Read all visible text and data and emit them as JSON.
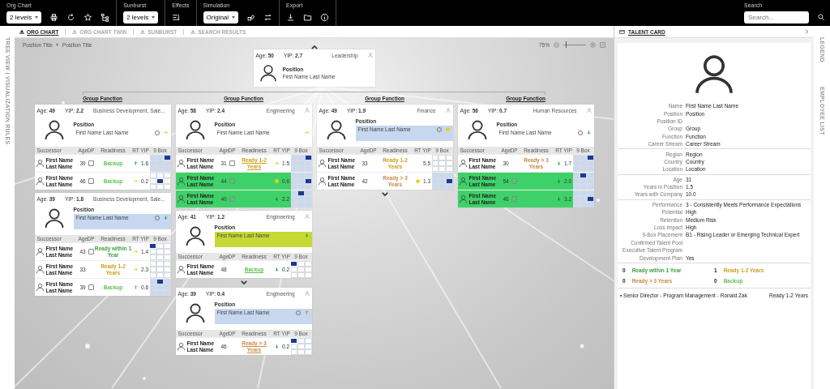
{
  "toolbar": {
    "groups": [
      {
        "label": "Org Chart",
        "dropdown": "2 levels"
      },
      {
        "label": "Sunburst",
        "dropdown": "2 levels"
      },
      {
        "label": "Effects"
      },
      {
        "label": "Simulation",
        "dropdown": "Original"
      },
      {
        "label": "Export"
      }
    ],
    "search": {
      "label": "Search",
      "placeholder": "Search..."
    }
  },
  "side_left": {
    "label": "TREE VIEW / VISUALIZATION RULES"
  },
  "tabs": [
    {
      "label": "ORG CHART",
      "selected": true
    },
    {
      "label": "ORG CHART TWIN",
      "selected": false
    },
    {
      "label": "SUNBURST",
      "selected": false
    },
    {
      "label": "SEARCH RESULTS",
      "selected": false
    }
  ],
  "breadcrumb": [
    "Position Title",
    "Position Title"
  ],
  "zoom": {
    "reading": "75%",
    "level": 0.1
  },
  "top_card": {
    "age": "Age: **50**",
    "yip": "YIP: **2.7**",
    "function": "Leadership",
    "position": "Position",
    "name": "First Name Last Name"
  },
  "columns": [
    {
      "title": "Group Function",
      "cards": [
        {
          "age": "Age: **49**",
          "yip": "YIP: **2.2**",
          "function": "Business Development, Sale...",
          "position": "Position",
          "name": {
            "text": "First Name Last Name",
            "highlighted": false
          },
          "status_icon": true,
          "rt": {
            "kind": "arrow-right",
            "color": "#e8d21a"
          },
          "more_below": false,
          "headers": [
            "Successor",
            "Age",
            "DP",
            "Readiness",
            "RT",
            "YIP",
            "9 Box"
          ],
          "successors": [
            {
              "first": "First Name",
              "last": "Last Name",
              "age": "39",
              "dp": true,
              "readiness": "Backup",
              "color": "#5fbf55",
              "link": false,
              "rt": {
                "kind": "arrow-up",
                "color": "#2e9e3a"
              },
              "yip": "1.6",
              "nine_box": {
                "kind": "top-right",
                "shaded": true
              },
              "highlighted": false
            },
            {
              "first": "First Name",
              "last": "Last Name",
              "age": "46",
              "dp": true,
              "readiness": "Backup",
              "color": "#5fbf55",
              "link": false,
              "rt": {
                "kind": "arrow-right",
                "color": "#e8d21a"
              },
              "yip": "0.2",
              "nine_box": {
                "kind": "middle-center",
                "shaded": false
              },
              "highlighted": false
            }
          ]
        },
        {
          "age": "Age: **39**",
          "yip": "YIP: **1.8**",
          "function": "Business Development, Sale...",
          "position": "Position",
          "name": {
            "text": "First Name Last Name",
            "highlighted": true,
            "color": "#c6d7ef"
          },
          "status_icon": true,
          "rt": {
            "kind": "arrow-down",
            "color": "#2e9e3a"
          },
          "more_below": false,
          "headers": [
            "Successor",
            "Age",
            "DP",
            "Readiness",
            "RT",
            "YIP",
            "9 Box"
          ],
          "successors": [
            {
              "first": "First Name",
              "last": "Last Name",
              "age": "43",
              "dp": true,
              "readiness": "Ready within 1 Year",
              "color": "#3e9e3e",
              "link": false,
              "rt": {
                "kind": "arrow-right",
                "color": "#e8d21a"
              },
              "yip": "1.4",
              "nine_box": {
                "kind": "top-left",
                "shaded": false
              },
              "highlighted": false
            },
            {
              "first": "First Name",
              "last": "Last Name",
              "age": "33",
              "dp": false,
              "readiness": "Ready 1-2 Years",
              "color": "#c9a21c",
              "link": false,
              "rt": {
                "kind": "arrow-right",
                "color": "#e8d21a"
              },
              "yip": "2.3",
              "nine_box": {
                "shaded": false
              },
              "highlighted": false
            },
            {
              "first": "First Name",
              "last": "Last Name",
              "age": "39",
              "dp": true,
              "readiness": "Backup",
              "color": "#5fbf55",
              "link": false,
              "rt": {
                "kind": "arrow-up",
                "color": "#b58b3a"
              },
              "yip": "0.6",
              "nine_box": {
                "kind": "top-center",
                "shaded": true
              },
              "highlighted": false
            }
          ]
        }
      ]
    },
    {
      "title": "Group Function",
      "cards": [
        {
          "age": "Age: **58**",
          "yip": "YIP: **2.4**",
          "function": "Engineering",
          "position": "Position",
          "name": {
            "text": "First Name Last Name",
            "highlighted": false
          },
          "status_icon": false,
          "rt": {
            "kind": "arrow-right",
            "color": "#e8d21a"
          },
          "more_below": false,
          "headers": [
            "Successor",
            "Age",
            "DP",
            "Readiness",
            "RT",
            "YIP",
            "9 Box"
          ],
          "successors": [
            {
              "first": "First Name",
              "last": "Last Name",
              "age": "31",
              "dp": true,
              "readiness": "Ready 1-2 Years",
              "color": "#c9a21c",
              "link": true,
              "rt": {
                "kind": "arrow-right",
                "color": "#e8d21a"
              },
              "yip": "1.5",
              "nine_box": {
                "kind": "top-right",
                "shaded": true
              },
              "highlighted": false
            },
            {
              "first": "First Name",
              "last": "Last Name",
              "age": "44",
              "dp": true,
              "rt": {
                "kind": "star",
                "color": "#e8d21a"
              },
              "yip": "0.6",
              "nine_box": {
                "kind": "middle-right",
                "shaded": true
              },
              "highlighted": true
            },
            {
              "first": "First Name",
              "last": "Last Name",
              "age": "40",
              "dp": true,
              "rt": {
                "kind": "arrow-down",
                "color": "#1f7a2a"
              },
              "yip": "2.2",
              "nine_box": {
                "kind": "top-center",
                "shaded": true
              },
              "highlighted": true
            }
          ]
        },
        {
          "age": "Age: **41**",
          "yip": "YIP: **1.2**",
          "function": "Engineering",
          "position": "Position",
          "name": {
            "text": "First Name Last Name",
            "highlighted": true,
            "color": "#c6d934"
          },
          "status_icon": false,
          "rt": {
            "kind": "arrow-down",
            "color": "#2e9e3a"
          },
          "more_below": true,
          "headers": [
            "Successor",
            "Age",
            "DP",
            "Readiness",
            "RT",
            "YIP",
            "9 Box"
          ],
          "successors": [
            {
              "first": "First Name",
              "last": "Last Name",
              "age": "48",
              "dp": false,
              "readiness": "Backup",
              "color": "#5fbf55",
              "link": true,
              "rt": {
                "kind": "arrow-down",
                "color": "#2e9e3a"
              },
              "yip": "0.2",
              "nine_box": {
                "kind": "top-left",
                "shaded": false
              },
              "highlighted": false
            }
          ]
        },
        {
          "age": "Age: **39**",
          "yip": "YIP: **0.4**",
          "function": "Engineering",
          "position": "Position",
          "name": {
            "text": "First Name Last Name",
            "highlighted": true,
            "color": "#c6d7ef"
          },
          "status_icon": true,
          "rt": {
            "kind": "arrow-up",
            "color": "#b58b3a"
          },
          "more_below": false,
          "headers": [
            "Successor",
            "Age",
            "DP",
            "Readiness",
            "RT",
            "YIP",
            "9 Box"
          ],
          "successors": [
            {
              "first": "First Name",
              "last": "Last Name",
              "age": "46",
              "dp": false,
              "readiness": "Ready > 3 Years",
              "color": "#c98a45",
              "link": true,
              "rt": {
                "kind": "arrow-down",
                "color": "#2e9e3a"
              },
              "yip": "0.2",
              "nine_box": {
                "kind": "top-left",
                "shaded": false
              },
              "highlighted": false
            }
          ]
        }
      ]
    },
    {
      "title": "Group Function",
      "cards": [
        {
          "age": "Age: **49**",
          "yip": "YIP: **1.9**",
          "function": "Finance",
          "position": "Position",
          "name": {
            "text": "First Name Last Name",
            "highlighted": true,
            "color": "#c6d7ef"
          },
          "status_icon": true,
          "rt": {
            "kind": "star",
            "color": "#e8d21a"
          },
          "more_below": true,
          "headers": [
            "Successor",
            "Age",
            "DP",
            "Readiness",
            "RT",
            "YIP",
            "9 Box"
          ],
          "successors": [
            {
              "first": "First Name",
              "last": "Last Name",
              "age": "33",
              "dp": false,
              "readiness": "Ready 1-2 Years",
              "color": "#c9a21c",
              "link": false,
              "yip": "5.5",
              "nine_box": {
                "shaded": false
              },
              "highlighted": false
            },
            {
              "first": "First Name",
              "last": "Last Name",
              "age": "42",
              "dp": false,
              "readiness": "Ready > 3 Years",
              "color": "#c98a45",
              "link": false,
              "rt": {
                "kind": "star",
                "color": "#e8d21a"
              },
              "yip": "1.3",
              "nine_box": {
                "kind": "middle-right",
                "shaded": true
              },
              "highlighted": false
            }
          ]
        }
      ]
    },
    {
      "title": "Group Function",
      "cards": [
        {
          "age": "Age: **56**",
          "yip": "YIP: **0.7**",
          "function": "Human Resources",
          "position": "Position",
          "name": {
            "text": "First Name Last Name",
            "highlighted": false
          },
          "status_icon": true,
          "rt": {
            "kind": "arrow-down",
            "color": "#2e9e3a"
          },
          "more_below": false,
          "headers": [
            "Successor",
            "Age",
            "DP",
            "Readiness",
            "RT",
            "YIP",
            "9 Box"
          ],
          "successors": [
            {
              "first": "First Name",
              "last": "Last Name",
              "age": "30",
              "dp": false,
              "readiness": "Ready > 3 Years",
              "color": "#c98a45",
              "link": false,
              "rt": {
                "kind": "arrow-down",
                "color": "#2e9e3a"
              },
              "yip": "1.7",
              "nine_box": {
                "kind": "top-right",
                "shaded": true
              },
              "highlighted": false
            },
            {
              "first": "First Name",
              "last": "Last Name",
              "age": "54",
              "dp": true,
              "rt": {
                "kind": "arrow-down",
                "color": "#1f7a2a"
              },
              "yip": "2.0",
              "nine_box": {
                "kind": "top-center",
                "shaded": true
              },
              "highlighted": true
            },
            {
              "first": "First Name",
              "last": "Last Name",
              "age": "46",
              "dp": true,
              "rt": {
                "kind": "arrow-down",
                "color": "#1f7a2a"
              },
              "yip": "3.2",
              "nine_box": {
                "kind": "middle-right",
                "shaded": true
              },
              "highlighted": true
            }
          ]
        }
      ]
    }
  ],
  "talent_card": {
    "title": "TALENT CARD",
    "sections": [
      [
        {
          "label": "Name",
          "value": "First Name Last Name"
        },
        {
          "label": "Position",
          "value": "Position"
        },
        {
          "label": "Position ID"
        },
        {
          "label": "Group",
          "value": "Group"
        },
        {
          "label": "Function",
          "value": "Function"
        },
        {
          "label": "Career Stream",
          "value": "Career Stream"
        }
      ],
      [
        {
          "label": "Region",
          "value": "Region"
        },
        {
          "label": "Country",
          "value": "Country"
        },
        {
          "label": "Location",
          "value": "Location"
        }
      ],
      [
        {
          "label": "Age",
          "value": "31"
        },
        {
          "label": "Years in Position",
          "value": "1.5"
        },
        {
          "label": "Years with Company",
          "value": "10.0"
        }
      ],
      [
        {
          "label": "Performance",
          "value": "3 - Consistently Meets Performance Expectations"
        },
        {
          "label": "Potential",
          "value": "High"
        },
        {
          "label": "Retention",
          "value": "Medium Risk"
        },
        {
          "label": "Loss Impact",
          "value": "High"
        },
        {
          "label": "9-Box Placement",
          "value": "B1 - Rising Leader or Emerging Technical Expert"
        },
        {
          "label": "Confirmed Talent Pool"
        },
        {
          "label": "Executive Talent Program"
        },
        {
          "label": "Development Plan",
          "value": "Yes"
        }
      ]
    ],
    "summary": [
      {
        "count": "0",
        "label": "Ready within 1 Year",
        "color": "#3e9e3e"
      },
      {
        "count": "1",
        "label": "Ready 1-2 Years",
        "color": "#c9a21c"
      },
      {
        "count": "0",
        "label": "Ready > 3 Years",
        "color": "#c98a45"
      },
      {
        "count": "0",
        "label": "Backup",
        "color": "#5fbf55"
      }
    ],
    "footer": {
      "text": "▪ Senior Director - Program Management - Ronald Zak",
      "readiness": "Ready 1-2 Years"
    }
  },
  "side_right": [
    "LEGEND",
    "EMPLOYEE LIST"
  ]
}
